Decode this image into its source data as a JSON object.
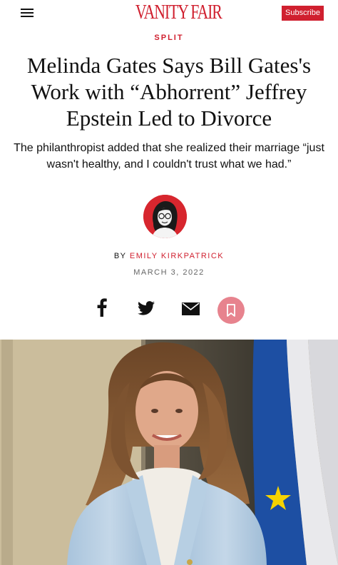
{
  "header": {
    "logo_text": "VANITY FAIR",
    "subscribe_label": "Subscribe"
  },
  "article": {
    "section": "SPLIT",
    "headline": "Melinda Gates Says Bill Gates's Work with “Abhorrent” Jeffrey Epstein Led to Divorce",
    "dek": "The philanthropist added that she realized their marriage “just wasn't healthy, and I couldn't trust what we had.”",
    "byline_prefix": "BY",
    "author": "EMILY KIRKPATRICK",
    "date": "MARCH 3, 2022"
  },
  "share": {
    "items": [
      "facebook-icon",
      "twitter-icon",
      "email-icon",
      "bookmark-icon"
    ]
  },
  "colors": {
    "brand": "#d0202f",
    "bookmark_bg": "#e7838e"
  }
}
